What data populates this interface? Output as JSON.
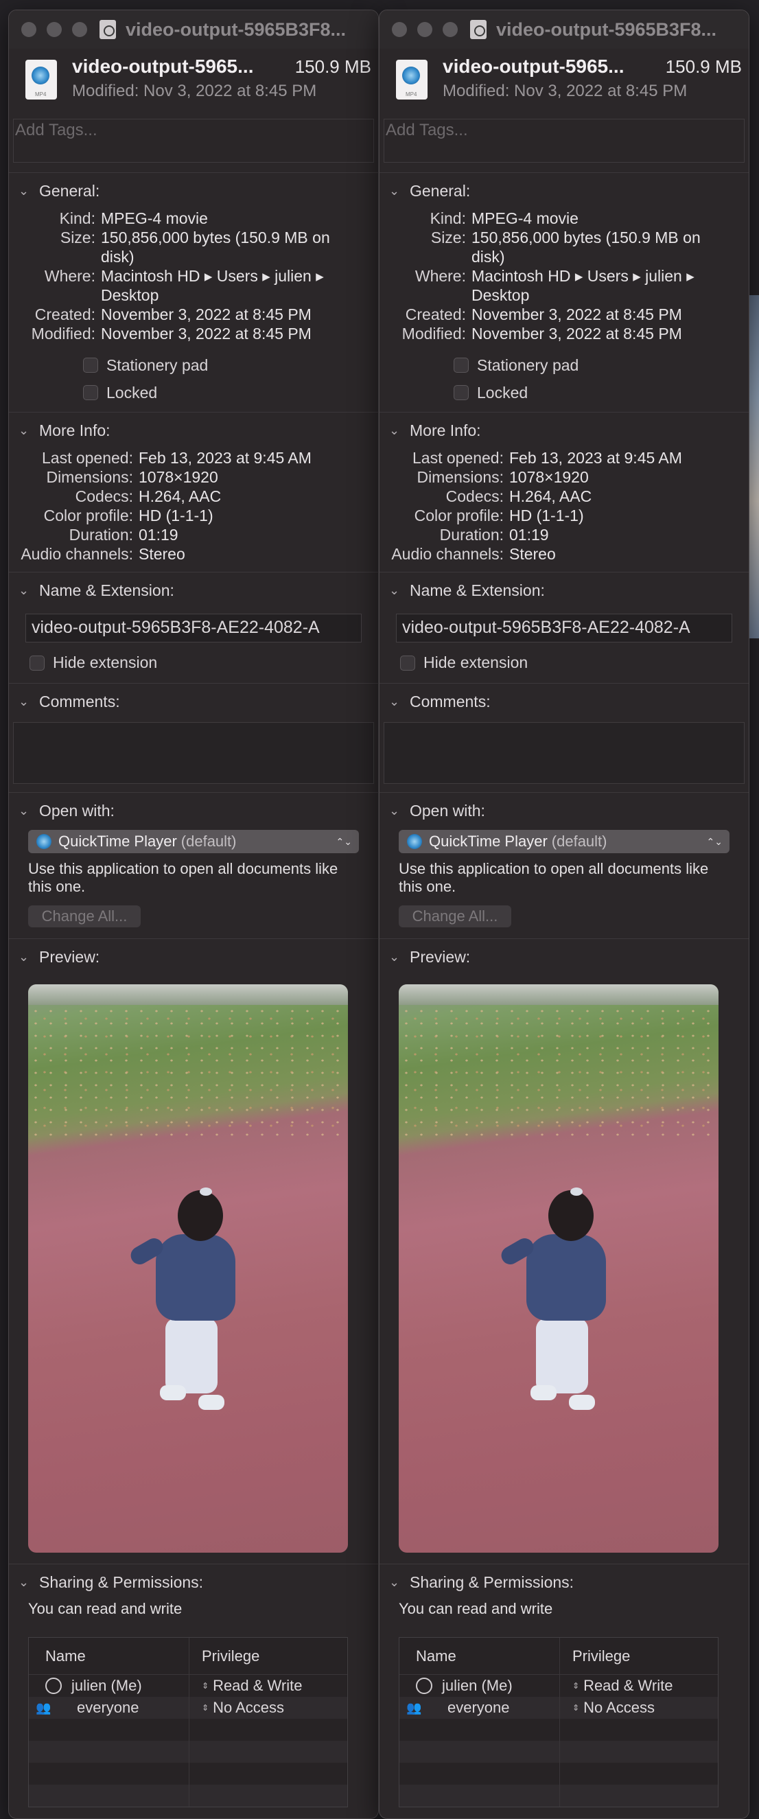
{
  "windows": [
    {
      "title": "video-output-5965B3F8...",
      "file_name": "video-output-5965...",
      "file_size": "150.9 MB",
      "modified_short": "Modified: Nov 3, 2022 at 8:45 PM",
      "tags_placeholder": "Add Tags...",
      "general": {
        "label": "General:",
        "kind_k": "Kind:",
        "kind_v": "MPEG-4 movie",
        "size_k": "Size:",
        "size_v": "150,856,000 bytes (150.9 MB on disk)",
        "where_k": "Where:",
        "where_v": "Macintosh HD ▸ Users ▸ julien ▸ Desktop",
        "created_k": "Created:",
        "created_v": "November 3, 2022 at 8:45 PM",
        "modified_k": "Modified:",
        "modified_v": "November 3, 2022 at 8:45 PM",
        "stationery": "Stationery pad",
        "locked": "Locked"
      },
      "more_info": {
        "label": "More Info:",
        "last_opened_k": "Last opened:",
        "last_opened_v": "Feb 13, 2023 at 9:45 AM",
        "dimensions_k": "Dimensions:",
        "dimensions_v": "1078×1920",
        "codecs_k": "Codecs:",
        "codecs_v": "H.264, AAC",
        "color_k": "Color profile:",
        "color_v": "HD (1-1-1)",
        "duration_k": "Duration:",
        "duration_v": "01:19",
        "audio_k": "Audio channels:",
        "audio_v": "Stereo"
      },
      "name_ext": {
        "label": "Name & Extension:",
        "value": "video-output-5965B3F8-AE22-4082-A",
        "hide": "Hide extension"
      },
      "comments": {
        "label": "Comments:"
      },
      "open_with": {
        "label": "Open with:",
        "app": "QuickTime Player",
        "default": "(default)",
        "text": "Use this application to open all documents like this one.",
        "button": "Change All..."
      },
      "preview": {
        "label": "Preview:"
      },
      "sharing": {
        "label": "Sharing & Permissions:",
        "text": "You can read and write",
        "col_name": "Name",
        "col_priv": "Privilege",
        "rows": [
          {
            "name": "julien (Me)",
            "priv": "Read & Write"
          },
          {
            "name": "everyone",
            "priv": "No Access"
          }
        ]
      }
    },
    {
      "title": "video-output-5965B3F8...",
      "file_name": "video-output-5965...",
      "file_size": "150.9 MB",
      "modified_short": "Modified: Nov 3, 2022 at 8:45 PM",
      "tags_placeholder": "Add Tags...",
      "general": {
        "label": "General:",
        "kind_k": "Kind:",
        "kind_v": "MPEG-4 movie",
        "size_k": "Size:",
        "size_v": "150,856,000 bytes (150.9 MB on disk)",
        "where_k": "Where:",
        "where_v": "Macintosh HD ▸ Users ▸ julien ▸ Desktop",
        "created_k": "Created:",
        "created_v": "November 3, 2022 at 8:45 PM",
        "modified_k": "Modified:",
        "modified_v": "November 3, 2022 at 8:45 PM",
        "stationery": "Stationery pad",
        "locked": "Locked"
      },
      "more_info": {
        "label": "More Info:",
        "last_opened_k": "Last opened:",
        "last_opened_v": "Feb 13, 2023 at 9:45 AM",
        "dimensions_k": "Dimensions:",
        "dimensions_v": "1078×1920",
        "codecs_k": "Codecs:",
        "codecs_v": "H.264, AAC",
        "color_k": "Color profile:",
        "color_v": "HD (1-1-1)",
        "duration_k": "Duration:",
        "duration_v": "01:19",
        "audio_k": "Audio channels:",
        "audio_v": "Stereo"
      },
      "name_ext": {
        "label": "Name & Extension:",
        "value": "video-output-5965B3F8-AE22-4082-A",
        "hide": "Hide extension"
      },
      "comments": {
        "label": "Comments:"
      },
      "open_with": {
        "label": "Open with:",
        "app": "QuickTime Player",
        "default": "(default)",
        "text": "Use this application to open all documents like this one.",
        "button": "Change All..."
      },
      "preview": {
        "label": "Preview:"
      },
      "sharing": {
        "label": "Sharing & Permissions:",
        "text": "You can read and write",
        "col_name": "Name",
        "col_priv": "Privilege",
        "rows": [
          {
            "name": "julien (Me)",
            "priv": "Read & Write"
          },
          {
            "name": "everyone",
            "priv": "No Access"
          }
        ]
      }
    }
  ]
}
